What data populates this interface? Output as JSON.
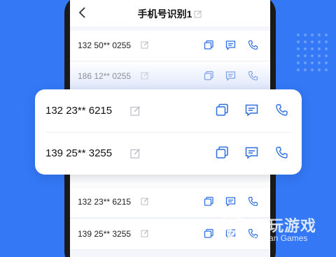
{
  "header": {
    "title": "手机号识别1"
  },
  "list_rows": [
    {
      "number": "132 50** 0255",
      "style": "normal"
    },
    {
      "number": "186 12** 0255",
      "style": "faded"
    },
    {
      "number": "132 23** 6215",
      "style": "normal"
    },
    {
      "number": "139 25** 3255",
      "style": "normal"
    }
  ],
  "popup_card": {
    "rows": [
      {
        "number": "132 23** 6215"
      },
      {
        "number": "139 25** 3255"
      }
    ]
  },
  "icons": {
    "back": "chevron-left-icon",
    "edit": "pencil-square-icon",
    "copy": "copy-icon",
    "message": "message-icon",
    "call": "phone-icon"
  },
  "colors": {
    "background": "#3478f6",
    "accent": "#2f6fe0",
    "muted_icon": "#b8bcc4"
  },
  "watermark": {
    "cn": "仍玩游戏",
    "en": "ngwan Games"
  }
}
